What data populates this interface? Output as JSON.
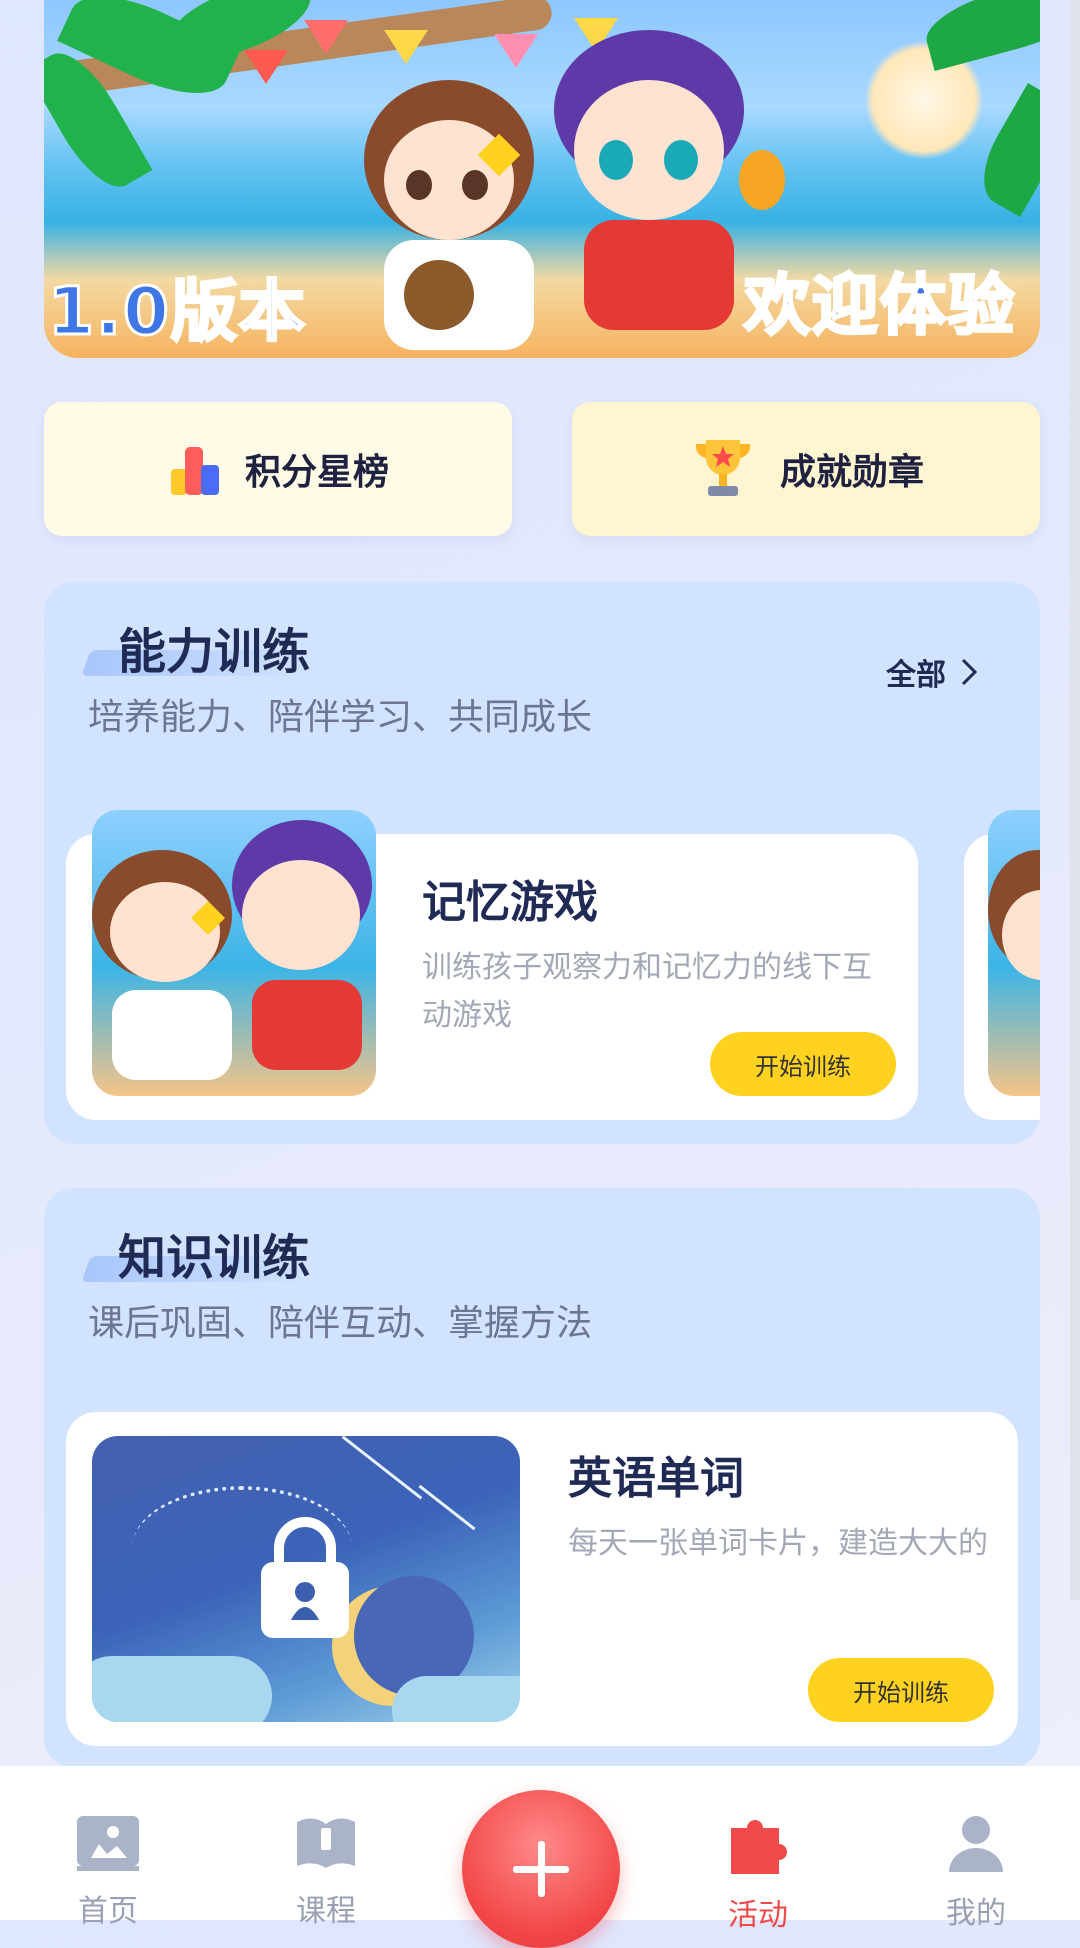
{
  "banner": {
    "left_text": "1.0版本",
    "right_text": "欢迎体验"
  },
  "quick": [
    {
      "label": "积分星榜",
      "icon": "bar-chart-icon"
    },
    {
      "label": "成就勋章",
      "icon": "trophy-icon"
    }
  ],
  "ability": {
    "title": "能力训练",
    "subtitle": "培养能力、陪伴学习、共同成长",
    "view_all": "全部",
    "card": {
      "title": "记忆游戏",
      "desc": "训练孩子观察力和记忆力的线下互动游戏",
      "button": "开始训练"
    }
  },
  "knowledge": {
    "title": "知识训练",
    "subtitle": "课后巩固、陪伴互动、掌握方法",
    "card": {
      "title": "英语单词",
      "desc": "每天一张单词卡片，建造大大的",
      "button": "开始训练",
      "locked": true
    }
  },
  "nav": [
    {
      "label": "首页",
      "icon": "home-icon"
    },
    {
      "label": "课程",
      "icon": "book-icon"
    },
    {
      "label": "",
      "icon": "plus-icon"
    },
    {
      "label": "活动",
      "icon": "puzzle-icon",
      "active": true
    },
    {
      "label": "我的",
      "icon": "user-icon"
    }
  ],
  "colors": {
    "accent": "#ffd21f",
    "active": "#f04a4a",
    "section_bg": "#d2e3ff",
    "title": "#1f2a55"
  }
}
